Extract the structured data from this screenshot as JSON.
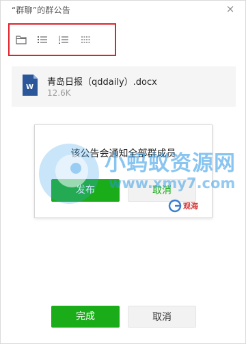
{
  "window": {
    "title": "“群聊”的群公告",
    "close_glyph": "×"
  },
  "toolbar": {
    "items": [
      {
        "name": "folder-icon"
      },
      {
        "name": "bullet-list-icon"
      },
      {
        "name": "numbered-list-icon"
      },
      {
        "name": "dotted-list-icon"
      }
    ]
  },
  "file": {
    "name": "青岛日报（qddaily）.docx",
    "size": "12.6K",
    "icon_letter": "W"
  },
  "dialog": {
    "message": "该公告会通知全部群成员",
    "confirm_label": "发布",
    "cancel_label": "取消"
  },
  "footer": {
    "done_label": "完成",
    "cancel_label": "取消"
  },
  "watermark": {
    "site_name": "小蚂蚁资源网",
    "url": "www.xmy7.com",
    "logo_text": "观海"
  },
  "colors": {
    "accent_green": "#1aad19",
    "highlight_red": "#e0212a",
    "word_blue": "#2b579a"
  }
}
